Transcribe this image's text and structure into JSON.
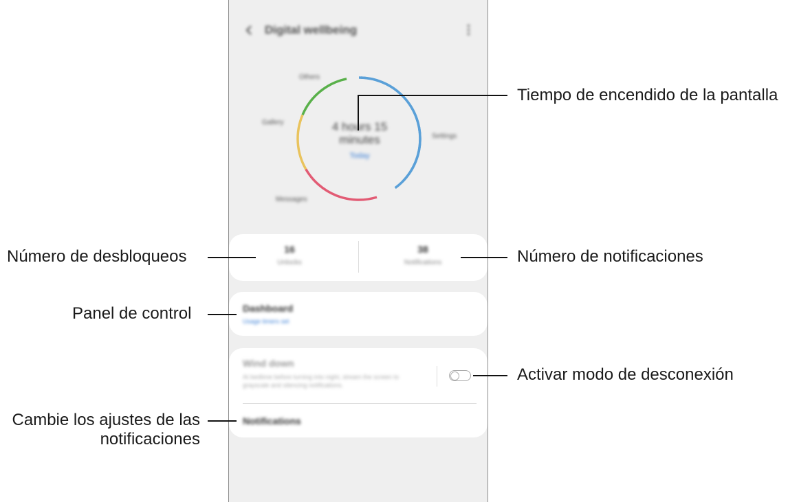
{
  "app": {
    "title": "Digital wellbeing"
  },
  "donut": {
    "center_line1": "4 hours 15",
    "center_line2": "minutes",
    "center_link": "Today",
    "labels": {
      "top": "Others",
      "left": "Gallery",
      "right": "Settings",
      "bottom": "Messages"
    },
    "segment_colors": [
      "#5aa0d8",
      "#e25b74",
      "#e9c35d",
      "#59b04a"
    ]
  },
  "stats": {
    "unlocks_value": "16",
    "unlocks_label": "Unlocks",
    "notifications_value": "38",
    "notifications_label": "Notifications"
  },
  "dashboard": {
    "title": "Dashboard",
    "link": "Usage timers set"
  },
  "wind_down": {
    "title": "Wind down",
    "description": "At bedtime before turning into night, stream the screen to grayscale and silencing notifications.",
    "enabled": false
  },
  "notifications_item": {
    "label": "Notifications"
  },
  "callouts": {
    "screen_time": "Tiempo de encendido de la pantalla",
    "unlocks": "Número de desbloqueos",
    "notifications_count": "Número de notificaciones",
    "dashboard": "Panel de control",
    "wind_down": "Activar modo de desconexión",
    "notif_settings_line1": "Cambie los ajustes de las",
    "notif_settings_line2": "notificaciones"
  }
}
